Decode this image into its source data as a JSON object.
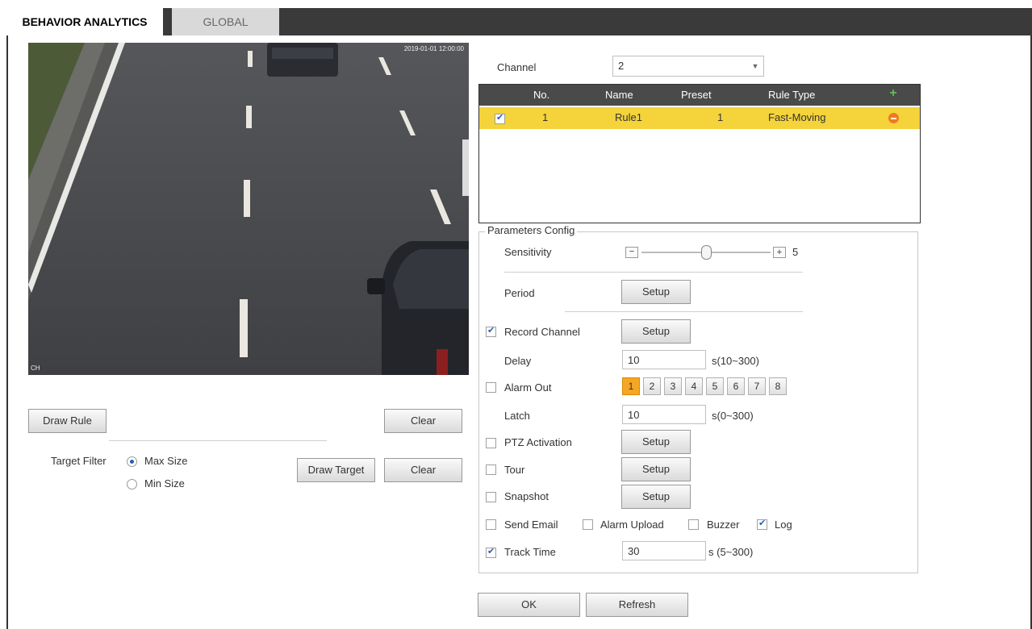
{
  "tabs": [
    {
      "label": "BEHAVIOR ANALYTICS",
      "active": true
    },
    {
      "label": "GLOBAL",
      "active": false
    }
  ],
  "video": {
    "timestamp": "2019-01-01 12:00:00",
    "channel_tag": "CH"
  },
  "left_panel": {
    "draw_rule_label": "Draw Rule",
    "clear_label": "Clear",
    "target_filter_label": "Target Filter",
    "max_size_label": "Max Size",
    "min_size_label": "Min Size",
    "selected_filter": "Max Size",
    "draw_target_label": "Draw Target",
    "clear_target_label": "Clear"
  },
  "channel": {
    "label": "Channel",
    "value": "2"
  },
  "rule_table": {
    "columns": [
      "No.",
      "Name",
      "Preset",
      "Rule Type"
    ],
    "rows": [
      {
        "checked": true,
        "no": "1",
        "name": "Rule1",
        "preset": "1",
        "rule_type": "Fast-Moving"
      }
    ]
  },
  "params": {
    "legend": "Parameters Config",
    "sensitivity_label": "Sensitivity",
    "sensitivity_value": "5",
    "sensitivity_level": 5,
    "sensitivity_max": 10,
    "period_label": "Period",
    "setup_label": "Setup",
    "record_channel_label": "Record Channel",
    "record_channel_checked": true,
    "delay_label": "Delay",
    "delay_value": "10",
    "delay_range": "s(10~300)",
    "alarm_out_label": "Alarm Out",
    "alarm_out_checked": false,
    "alarm_outputs": [
      "1",
      "2",
      "3",
      "4",
      "5",
      "6",
      "7",
      "8"
    ],
    "alarm_active": "1",
    "latch_label": "Latch",
    "latch_value": "10",
    "latch_range": "s(0~300)",
    "ptz_label": "PTZ Activation",
    "tour_label": "Tour",
    "snapshot_label": "Snapshot",
    "send_email_label": "Send Email",
    "alarm_upload_label": "Alarm Upload",
    "buzzer_label": "Buzzer",
    "log_label": "Log",
    "log_checked": true,
    "track_time_label": "Track Time",
    "track_time_checked": true,
    "track_time_value": "30",
    "track_time_range": "s (5~300)"
  },
  "footer": {
    "ok_label": "OK",
    "refresh_label": "Refresh"
  }
}
